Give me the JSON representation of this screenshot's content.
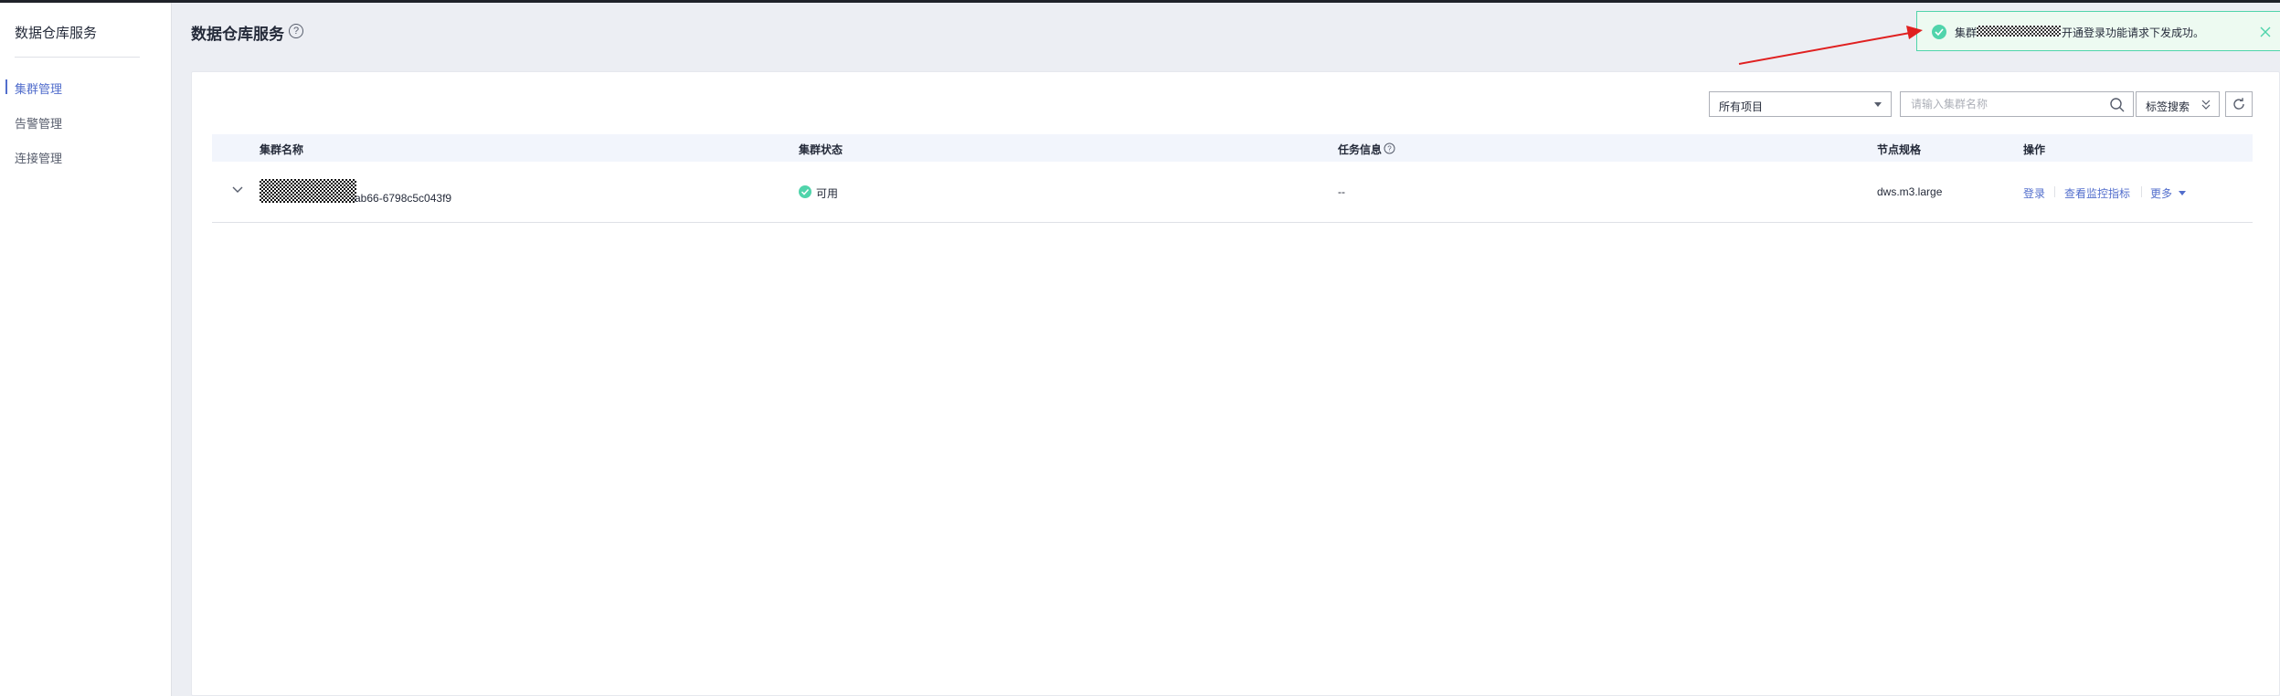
{
  "sidebar": {
    "title": "数据仓库服务",
    "items": [
      {
        "label": "集群管理",
        "active": true
      },
      {
        "label": "告警管理",
        "active": false
      },
      {
        "label": "连接管理",
        "active": false
      }
    ]
  },
  "header": {
    "title": "数据仓库服务",
    "help_glyph": "?"
  },
  "toolbar": {
    "project_select_value": "所有项目",
    "search_placeholder": "请输入集群名称",
    "tag_search_label": "标签搜索"
  },
  "table": {
    "columns": [
      "集群名称",
      "集群状态",
      "任务信息",
      "节点规格",
      "操作"
    ],
    "rows": [
      {
        "name_suffix": "-ab66-6798c5c043f9",
        "status": "可用",
        "task_info": "--",
        "node_spec": "dws.m3.large",
        "actions": {
          "login": "登录",
          "monitor": "查看监控指标",
          "more": "更多"
        }
      }
    ]
  },
  "notification": {
    "prefix": "集群",
    "message": "开通登录功能请求下发成功。"
  },
  "colors": {
    "accent": "#526ecc",
    "success": "#50d4ab",
    "annotation_arrow": "#e02020"
  }
}
